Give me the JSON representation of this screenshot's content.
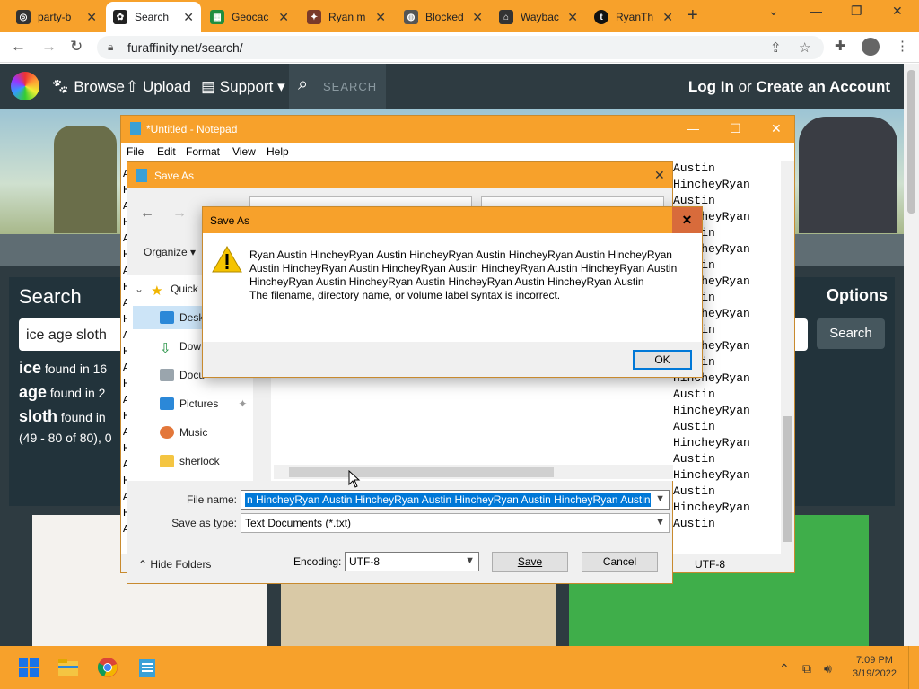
{
  "browser": {
    "tabs": [
      {
        "label": "party-b",
        "icon": "instagram-icon"
      },
      {
        "label": "Search",
        "icon": "paw-icon"
      },
      {
        "label": "Geocac",
        "icon": "sheets-icon"
      },
      {
        "label": "Ryan m",
        "icon": "fa-icon"
      },
      {
        "label": "Blocked",
        "icon": "globe-icon"
      },
      {
        "label": "Waybac",
        "icon": "archive-icon"
      },
      {
        "label": "RyanTh",
        "icon": "tumblr-icon"
      }
    ],
    "url": "furaffinity.net/search/"
  },
  "fa": {
    "nav": {
      "browse": "Browse",
      "upload": "Upload",
      "support": "Support",
      "search_placeholder": "SEARCH",
      "login": "Log In",
      "or": "or",
      "create": "Create an Account"
    },
    "search": {
      "title": "Search",
      "options": "Options",
      "query": "ice age sloth",
      "button": "Search",
      "results": [
        {
          "term": "ice",
          "text": "found in 16"
        },
        {
          "term": "age",
          "text": "found in 2"
        },
        {
          "term": "sloth",
          "text": "found in"
        }
      ],
      "range": "(49 - 80 of 80), 0"
    }
  },
  "notepad": {
    "title": "*Untitled - Notepad",
    "menu": [
      "File",
      "Edit",
      "Format",
      "View",
      "Help"
    ],
    "text_lines": [
      "Austin",
      "HincheyRyan",
      "Austin",
      "HincheyRyan",
      "Austin",
      "HincheyRyan",
      "Austin",
      "HincheyRyan",
      "Austin",
      "HincheyRyan",
      "Austin",
      "HincheyRyan",
      "Austin",
      "HincheyRyan",
      "Austin",
      "HincheyRyan",
      "Austin",
      "HincheyRyan",
      "Austin",
      "HincheyRyan",
      "Austin",
      "HincheyRyan",
      "Austin"
    ],
    "left_chars": [
      "A",
      "H",
      "A",
      "H",
      "A",
      "H",
      "A",
      "H",
      "A",
      "H",
      "A",
      "H",
      "A",
      "H",
      "A",
      "H",
      "A",
      "H",
      "A",
      "H",
      "A",
      "H",
      "A"
    ],
    "status_encoding": "UTF-8"
  },
  "save_as": {
    "title": "Save As",
    "organize": "Organize",
    "nav_items": [
      "Quick",
      "Desk",
      "Dow",
      "Docu",
      "Pictures",
      "Music",
      "sherlock"
    ],
    "file_name_label": "File name:",
    "file_name_value": "n HincheyRyan Austin HincheyRyan Austin HincheyRyan Austin HincheyRyan Austin",
    "save_type_label": "Save as type:",
    "save_type_value": "Text Documents (*.txt)",
    "hide_folders": "Hide Folders",
    "encoding_label": "Encoding:",
    "encoding_value": "UTF-8",
    "save_button": "Save",
    "cancel_button": "Cancel"
  },
  "error": {
    "title": "Save As",
    "message_name": "Ryan Austin HincheyRyan Austin HincheyRyan Austin HincheyRyan Austin HincheyRyan Austin HincheyRyan Austin HincheyRyan Austin HincheyRyan Austin HincheyRyan Austin HincheyRyan Austin HincheyRyan Austin HincheyRyan Austin HincheyRyan Austin",
    "message_detail": "The filename, directory name, or volume label syntax is incorrect.",
    "ok_button": "OK"
  },
  "taskbar": {
    "apps": [
      "start-icon",
      "file-explorer-icon",
      "chrome-icon",
      "notepad-icon"
    ],
    "time": "7:09 PM",
    "date": "3/19/2022"
  },
  "colors": {
    "accent_orange": "#f7a12b",
    "fa_dark": "#2e3b41",
    "selection_blue": "#0078d7"
  }
}
